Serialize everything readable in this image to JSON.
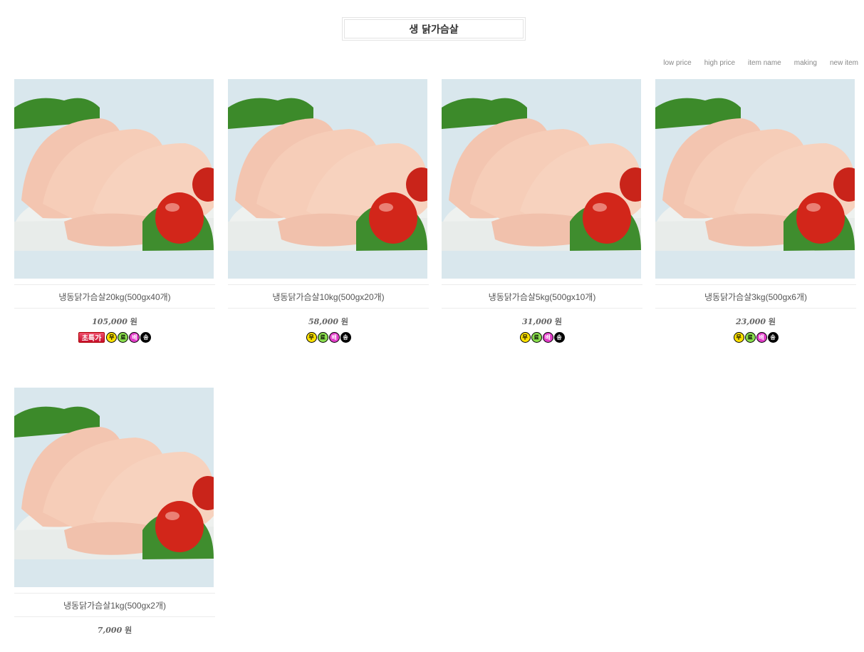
{
  "category_title": "생 닭가슴살",
  "sort_options": [
    "low price",
    "high price",
    "item name",
    "making",
    "new item"
  ],
  "currency": "원",
  "badges": {
    "hot": "초특가",
    "free_shipping": [
      "무",
      "료",
      "배",
      "송"
    ]
  },
  "products": [
    {
      "name": "냉동닭가슴살20kg(500gx40개)",
      "price": "105,000",
      "hot": true
    },
    {
      "name": "냉동닭가슴살10kg(500gx20개)",
      "price": "58,000",
      "hot": false
    },
    {
      "name": "냉동닭가슴살5kg(500gx10개)",
      "price": "31,000",
      "hot": false
    },
    {
      "name": "냉동닭가슴살3kg(500gx6개)",
      "price": "23,000",
      "hot": false
    },
    {
      "name": "냉동닭가슴살1kg(500gx2개)",
      "price": "7,000",
      "hot": false
    }
  ],
  "colors": {
    "image_bg": "#dce8ee",
    "meat": "#f4c9b4",
    "tomato": "#d8281a",
    "greens": "#3c8a2a"
  }
}
